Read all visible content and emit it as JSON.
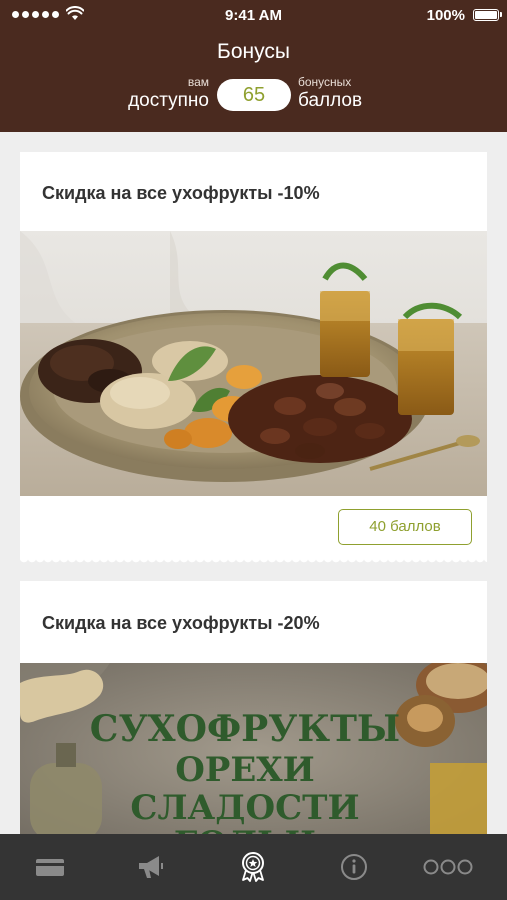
{
  "status_bar": {
    "time": "9:41 AM",
    "battery": "100%"
  },
  "header": {
    "title": "Бонусы",
    "available_small": "вам",
    "available_big": "доступно",
    "points_value": "65",
    "points_small": "бонусных",
    "points_big": "баллов"
  },
  "offers": [
    {
      "title": "Скидка на все ухофрукты -10%",
      "points_button": "40 баллов"
    },
    {
      "title": "Скидка на все ухофрукты -20%",
      "banner_lines": [
        "СУХОФРУКТЫ",
        "ОРЕХИ",
        "СЛАДОСТИ",
        "ГОЛЬЧ"
      ]
    }
  ],
  "tabbar": {
    "items": [
      "card-icon",
      "megaphone-icon",
      "award-icon",
      "info-icon",
      "more-icon"
    ],
    "active": "award-icon"
  },
  "colors": {
    "header_bg": "#4a2a1f",
    "accent_green": "#8fa02f",
    "tabbar_bg": "#343434",
    "tab_icon": "#8a8a8a",
    "tab_active": "#ffffff"
  }
}
